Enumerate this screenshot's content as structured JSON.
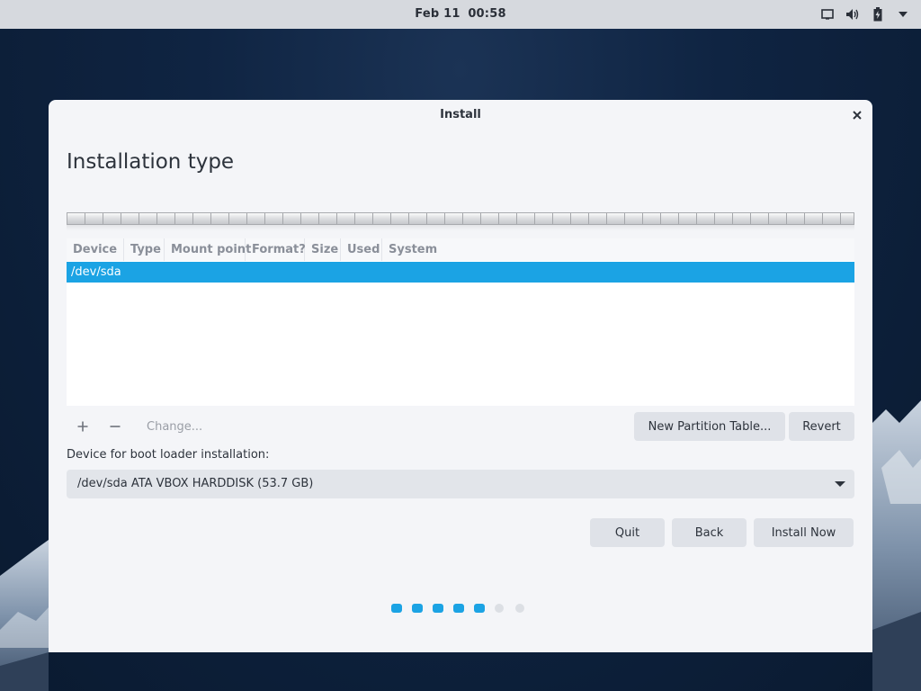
{
  "top_bar": {
    "date": "Feb 11",
    "time": "00:58",
    "tray_icons": [
      "display-icon",
      "volume-icon",
      "battery-icon",
      "menu-chevron-icon"
    ]
  },
  "window": {
    "title": "Install",
    "close_icon": "close-icon"
  },
  "page": {
    "title": "Installation type"
  },
  "partition_table": {
    "columns": [
      "Device",
      "Type",
      "Mount point",
      "Format?",
      "Size",
      "Used",
      "System"
    ],
    "rows": [
      {
        "device": "/dev/sda",
        "type": "",
        "mount_point": "",
        "format": "",
        "size": "",
        "used": "",
        "system": "",
        "selected": true
      }
    ]
  },
  "toolbar": {
    "add_icon": "plus-icon",
    "remove_icon": "minus-icon",
    "change_label": "Change...",
    "new_table_label": "New Partition Table...",
    "revert_label": "Revert"
  },
  "boot_loader": {
    "label": "Device for boot loader installation:",
    "selected": "/dev/sda ATA VBOX HARDDISK (53.7 GB)"
  },
  "actions": {
    "quit_label": "Quit",
    "back_label": "Back",
    "install_label": "Install Now"
  },
  "progress": {
    "total_steps": 7,
    "completed_steps": 5
  },
  "colors": {
    "accent": "#1ba3e4",
    "window_bg": "#f4f5f8",
    "button_bg": "#dfe2e8",
    "top_bar_bg": "#d6d9de"
  }
}
